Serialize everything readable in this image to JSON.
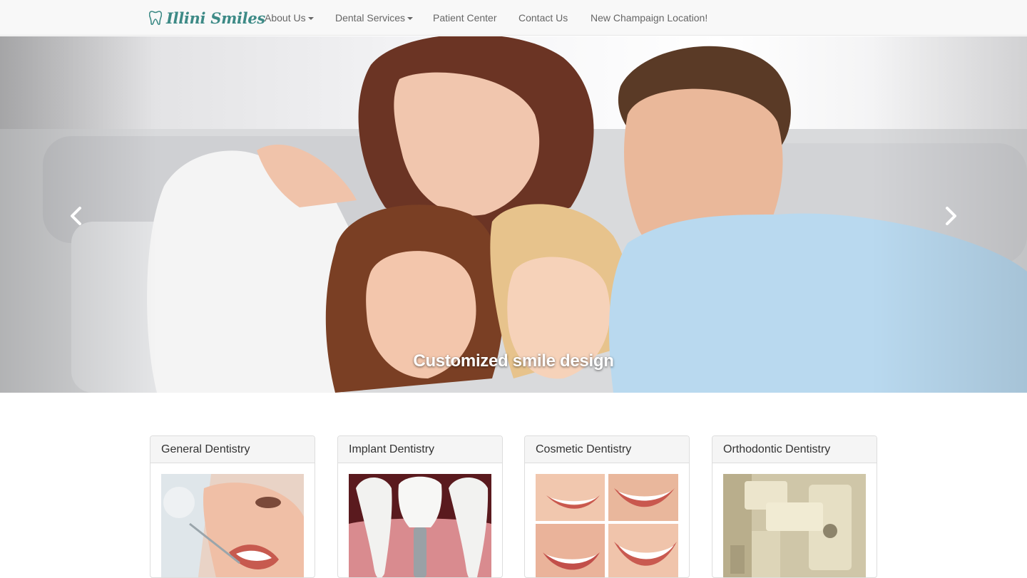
{
  "brand": {
    "name": "Illini Smiles",
    "icon": "tooth-icon",
    "color": "#3d8a86"
  },
  "nav": {
    "items": [
      {
        "label": "About Us",
        "dropdown": true
      },
      {
        "label": "Dental Services",
        "dropdown": true
      },
      {
        "label": "Patient Center",
        "dropdown": false
      },
      {
        "label": "Contact Us",
        "dropdown": false
      },
      {
        "label": "New Champaign Location!",
        "dropdown": false
      }
    ]
  },
  "carousel": {
    "caption": "Customized smile design",
    "prev_icon": "chevron-left-icon",
    "next_icon": "chevron-right-icon"
  },
  "services": [
    {
      "title": "General Dentistry",
      "image": "dental-exam-image"
    },
    {
      "title": "Implant Dentistry",
      "image": "dental-implant-image"
    },
    {
      "title": "Cosmetic Dentistry",
      "image": "smiles-collage-image"
    },
    {
      "title": "Orthodontic Dentistry",
      "image": "xray-machine-image"
    }
  ]
}
